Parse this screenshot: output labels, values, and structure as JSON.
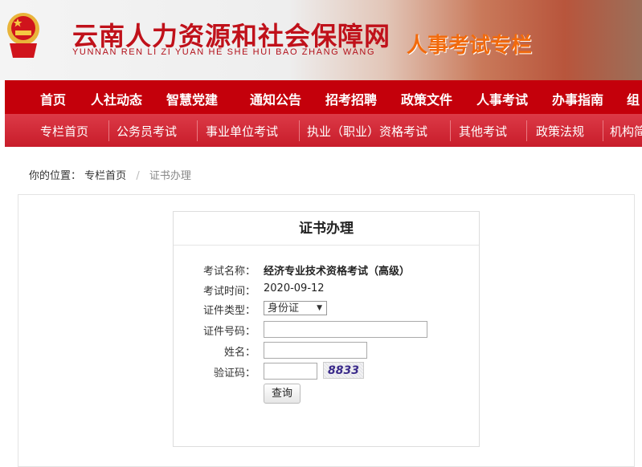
{
  "header": {
    "site_title": "云南人力资源和社会保障网",
    "site_pinyin": "YUNNAN REN LI ZI YUAN HE SHE HUI BAO ZHANG WANG",
    "column_title": "人事考试专栏",
    "emblem_icon": "national-emblem-icon"
  },
  "nav_main": [
    "首页",
    "人社动态",
    "智慧党建",
    "通知公告",
    "招考招聘",
    "政策文件",
    "人事考试",
    "办事指南",
    "组"
  ],
  "nav_sub": [
    "专栏首页",
    "公务员考试",
    "事业单位考试",
    "执业（职业）资格考试",
    "其他考试",
    "政策法规",
    "机构简介"
  ],
  "breadcrumb": {
    "prefix": "你的位置：",
    "home": "专栏首页",
    "separator": "/",
    "current": "证书办理"
  },
  "form": {
    "title": "证书办理",
    "exam_name_label": "考试名称：",
    "exam_name": "经济专业技术资格考试（高级）",
    "exam_time_label": "考试时间：",
    "exam_time": "2020-09-12",
    "id_type_label": "证件类型：",
    "id_type": "身份证",
    "id_number_label": "证件号码：",
    "id_number": "",
    "name_label": "姓名：",
    "name": "",
    "captcha_label": "验证码：",
    "captcha_input": "",
    "captcha_image": "8833",
    "submit": "查询"
  },
  "colors": {
    "nav_main_bg": "#c4000b",
    "nav_sub_bg": "#d42c3a",
    "title_red": "#c0111a",
    "column_orange": "#f26a0c"
  }
}
